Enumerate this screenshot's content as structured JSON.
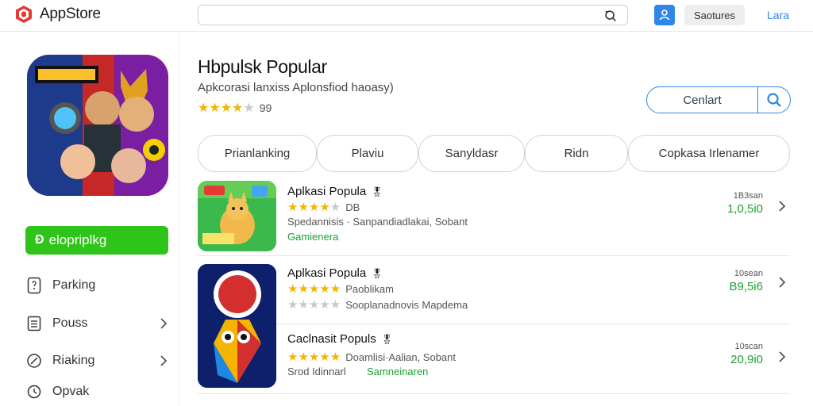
{
  "header": {
    "app_name": "AppStore",
    "search": {
      "value": "",
      "placeholder": ""
    },
    "sources_label": "Saotures",
    "lang_label": "Lara",
    "colors": {
      "brand_red": "#e53935",
      "accent_blue": "#2f86e8"
    },
    "icons": {
      "logo": "appstore-logo-icon",
      "search": "search-icon",
      "user": "user-icon"
    }
  },
  "sidebar": {
    "primary_button": {
      "label": "elopriplkg",
      "icon": "download-icon",
      "color": "#2ec41a"
    },
    "items": [
      {
        "label": "Parking",
        "icon": "document-icon",
        "has_chevron": false
      },
      {
        "label": "Pouss",
        "icon": "list-icon",
        "has_chevron": true
      },
      {
        "label": "Riaking",
        "icon": "tag-icon",
        "has_chevron": true
      },
      {
        "label": "Opvak",
        "icon": "clock-icon",
        "has_chevron": false
      }
    ]
  },
  "main": {
    "title": "Hbpulsk Popular",
    "subtitle": "Apkcorasi lanxiss Aplonsfiod haoasy)",
    "rating": {
      "stars": 4,
      "count": "99"
    },
    "action": {
      "label": "Cenlart",
      "icon": "search-icon"
    },
    "tabs": [
      {
        "label": "Prianlanking"
      },
      {
        "label": "Plaviu"
      },
      {
        "label": "Sanyldasr"
      },
      {
        "label": "Ridn"
      },
      {
        "label": "Copkasa Irlenamer"
      }
    ],
    "items": [
      {
        "name": "Aplkasi Popula",
        "stars": 4,
        "tag": "DB",
        "line1": "Spedannisis · Sanpandiadlakai, Sobant",
        "line2": "Gamienera",
        "meta_label": "1B3san",
        "meta_value": "1,0,5i0"
      },
      {
        "name": "Aplkasi Popula",
        "stars": 5,
        "tag": "Paoblikam",
        "line1": "Sooplanadnovis Mapdema",
        "line2": "",
        "meta_label": "10sean",
        "meta_value": "B9,5i6"
      },
      {
        "name": "Caclnasit Populs",
        "stars": 5,
        "tag": "Doamlisi·Aalian, Sobant",
        "line1": "Srod Idinnarl",
        "line2": "Samneinaren",
        "meta_label": "10scan",
        "meta_value": "20,9i0"
      }
    ]
  }
}
